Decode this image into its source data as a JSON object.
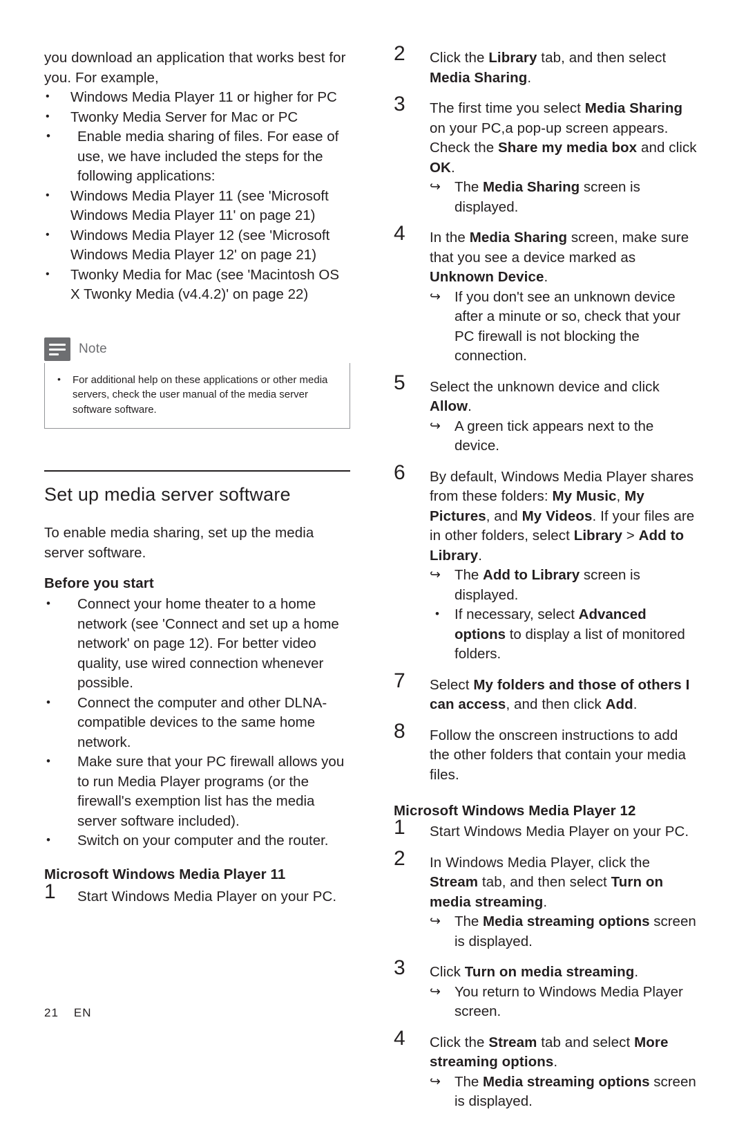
{
  "page": {
    "footer_page_number": "21",
    "footer_language": "EN"
  },
  "left_column": {
    "intro_para": "you download an application that works best for you. For example,",
    "intro_sub_bullets": [
      "Windows Media Player 11 or higher for PC",
      "Twonky Media Server for Mac or PC"
    ],
    "enable_bullet": "Enable media sharing of files. For ease of use, we have included the steps for the following applications:",
    "enable_sub_bullets": [
      "Windows Media Player 11 (see 'Microsoft Windows Media Player 11' on page 21)",
      "Windows Media Player 12 (see 'Microsoft Windows Media Player 12' on page 21)",
      "Twonky Media for Mac (see 'Macintosh OS X Twonky Media (v4.4.2)' on page 22)"
    ],
    "note": {
      "title": "Note",
      "icon": "note-lines-icon",
      "items": [
        "For additional help on these applications or other media servers, check the user manual of the media server software software."
      ]
    },
    "section_title": "Set up media server software",
    "section_intro": "To enable media sharing, set up the media server software.",
    "before_you_start_title": "Before you start",
    "before_you_start_bullets": [
      "Connect your home theater to a home network (see 'Connect and set up a home network' on page 12). For better video quality, use wired connection whenever possible.",
      "Connect the computer and other DLNA-compatible devices to the same home network.",
      "Make sure that your PC firewall allows you to run Media Player programs (or the firewall's exemption list has the media server software included).",
      "Switch on your computer and the router."
    ],
    "wmp11_title": "Microsoft Windows Media Player 11",
    "wmp11_step1_num": "1",
    "wmp11_step1_text": "Start Windows Media Player on your PC."
  },
  "right_column": {
    "wmp11_steps": [
      {
        "num": "2",
        "text_parts": [
          {
            "t": "Click the ",
            "b": false
          },
          {
            "t": "Library",
            "b": true
          },
          {
            "t": " tab, and then select ",
            "b": false
          },
          {
            "t": "Media Sharing",
            "b": true
          },
          {
            "t": ".",
            "b": false
          }
        ]
      },
      {
        "num": "3",
        "text_parts": [
          {
            "t": "The first time you select ",
            "b": false
          },
          {
            "t": "Media Sharing",
            "b": true
          },
          {
            "t": " on your PC,a pop-up screen appears. Check the ",
            "b": false
          },
          {
            "t": "Share my media box",
            "b": true
          },
          {
            "t": " and click ",
            "b": false
          },
          {
            "t": "OK",
            "b": true
          },
          {
            "t": ".",
            "b": false
          }
        ],
        "results": [
          [
            {
              "t": "The ",
              "b": false
            },
            {
              "t": "Media Sharing",
              "b": true
            },
            {
              "t": " screen is displayed.",
              "b": false
            }
          ]
        ]
      },
      {
        "num": "4",
        "text_parts": [
          {
            "t": "In the ",
            "b": false
          },
          {
            "t": "Media Sharing",
            "b": true
          },
          {
            "t": " screen, make sure that you see a device marked as ",
            "b": false
          },
          {
            "t": "Unknown Device",
            "b": true
          },
          {
            "t": ".",
            "b": false
          }
        ],
        "results": [
          [
            {
              "t": "If you don't see an unknown device after a minute or so, check that your PC firewall is not blocking the connection.",
              "b": false
            }
          ]
        ]
      },
      {
        "num": "5",
        "text_parts": [
          {
            "t": "Select the unknown device and click ",
            "b": false
          },
          {
            "t": "Allow",
            "b": true
          },
          {
            "t": ".",
            "b": false
          }
        ],
        "results": [
          [
            {
              "t": "A green tick appears next to the device.",
              "b": false
            }
          ]
        ]
      },
      {
        "num": "6",
        "text_parts": [
          {
            "t": "By default, Windows Media Player shares from these folders: ",
            "b": false
          },
          {
            "t": "My Music",
            "b": true
          },
          {
            "t": ", ",
            "b": false
          },
          {
            "t": "My Pictures",
            "b": true
          },
          {
            "t": ", and ",
            "b": false
          },
          {
            "t": "My Videos",
            "b": true
          },
          {
            "t": ". If your files are in other folders, select ",
            "b": false
          },
          {
            "t": "Library",
            "b": true
          },
          {
            "t": " > ",
            "b": false
          },
          {
            "t": "Add to Library",
            "b": true
          },
          {
            "t": ".",
            "b": false
          }
        ],
        "results": [
          [
            {
              "t": "The ",
              "b": false
            },
            {
              "t": "Add to Library",
              "b": true
            },
            {
              "t": " screen is displayed.",
              "b": false
            }
          ]
        ],
        "sub_bullets": [
          [
            {
              "t": "If necessary, select ",
              "b": false
            },
            {
              "t": "Advanced options",
              "b": true
            },
            {
              "t": " to display a list of monitored folders.",
              "b": false
            }
          ]
        ]
      },
      {
        "num": "7",
        "text_parts": [
          {
            "t": "Select ",
            "b": false
          },
          {
            "t": "My folders and those of others I can access",
            "b": true
          },
          {
            "t": ", and then click ",
            "b": false
          },
          {
            "t": "Add",
            "b": true
          },
          {
            "t": ".",
            "b": false
          }
        ]
      },
      {
        "num": "8",
        "text_parts": [
          {
            "t": "Follow the onscreen instructions to add the other folders that contain your media files.",
            "b": false
          }
        ]
      }
    ],
    "wmp12_title": "Microsoft Windows Media Player 12",
    "wmp12_steps": [
      {
        "num": "1",
        "text_parts": [
          {
            "t": "Start Windows Media Player on your PC.",
            "b": false
          }
        ]
      },
      {
        "num": "2",
        "text_parts": [
          {
            "t": "In Windows Media Player, click the ",
            "b": false
          },
          {
            "t": "Stream",
            "b": true
          },
          {
            "t": " tab, and then select ",
            "b": false
          },
          {
            "t": "Turn on media streaming",
            "b": true
          },
          {
            "t": ".",
            "b": false
          }
        ],
        "results": [
          [
            {
              "t": "The ",
              "b": false
            },
            {
              "t": "Media streaming options",
              "b": true
            },
            {
              "t": " screen is displayed.",
              "b": false
            }
          ]
        ]
      },
      {
        "num": "3",
        "text_parts": [
          {
            "t": "Click ",
            "b": false
          },
          {
            "t": "Turn on media streaming",
            "b": true
          },
          {
            "t": ".",
            "b": false
          }
        ],
        "results": [
          [
            {
              "t": "You return to Windows Media Player screen.",
              "b": false
            }
          ]
        ]
      },
      {
        "num": "4",
        "text_parts": [
          {
            "t": "Click the ",
            "b": false
          },
          {
            "t": "Stream",
            "b": true
          },
          {
            "t": " tab and select ",
            "b": false
          },
          {
            "t": "More streaming options",
            "b": true
          },
          {
            "t": ".",
            "b": false
          }
        ],
        "results": [
          [
            {
              "t": "The ",
              "b": false
            },
            {
              "t": "Media streaming options",
              "b": true
            },
            {
              "t": " screen is displayed.",
              "b": false
            }
          ]
        ]
      }
    ]
  }
}
